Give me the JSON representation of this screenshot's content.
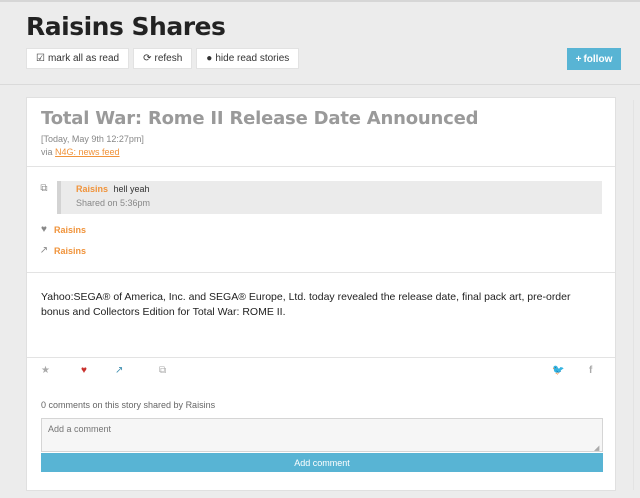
{
  "page": {
    "title": "Raisins Shares"
  },
  "toolbar": {
    "mark_read_label": "mark all as read",
    "refresh_label": "refesh",
    "hide_read_label": "hide read stories",
    "follow_label": "follow"
  },
  "story": {
    "title": "Total War: Rome II Release Date Announced",
    "date": "[Today, May 9th 12:27pm]",
    "via_prefix": "via",
    "via_source": "N4G: news feed",
    "body": "Yahoo:SEGA® of America, Inc. and SEGA® Europe, Ltd. today revealed the release date, final pack art, pre-order bonus and Collectors Edition for Total War: ROME II."
  },
  "activity": {
    "comment": {
      "user": "Raisins",
      "text": "hell yeah",
      "shared": "Shared on 5:36pm"
    },
    "liked_by": "Raisins",
    "shared_by": "Raisins"
  },
  "comments": {
    "count_text": "0 comments on this story shared by Raisins",
    "input_placeholder": "Add a comment",
    "submit_label": "Add comment"
  },
  "colors": {
    "accent_blue": "#58b4d4",
    "link_orange": "#f0933a",
    "heart_red": "#c9302c"
  }
}
